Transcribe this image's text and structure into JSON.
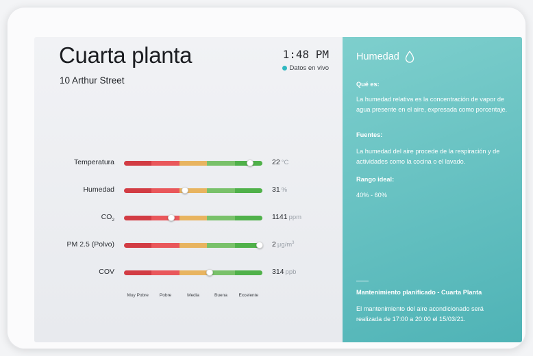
{
  "header": {
    "title": "Cuarta planta",
    "address": "10 Arthur Street",
    "time": "1:48 PM",
    "live_label": "Datos en vivo"
  },
  "metrics": [
    {
      "label": "Temperatura",
      "value": "22",
      "unit": "°C",
      "position": 0.91
    },
    {
      "label": "Humedad",
      "value": "31",
      "unit": "%",
      "position": 0.44
    },
    {
      "label": "CO",
      "label_sub": "2",
      "value": "1141",
      "unit": "ppm",
      "position": 0.34
    },
    {
      "label": "PM 2.5 (Polvo)",
      "value": "2",
      "unit": "μg/m",
      "unit_sup": "3",
      "position": 0.98
    },
    {
      "label": "COV",
      "value": "314",
      "unit": "ppb",
      "position": 0.62
    }
  ],
  "scale_labels": [
    "Muy Pobre",
    "Pobre",
    "Media",
    "Buena",
    "Excelente"
  ],
  "colors": {
    "very_poor": "#d23c44",
    "poor": "#e9575b",
    "medium": "#e8b460",
    "good": "#79c16a",
    "excellent": "#50b14a",
    "info_panel": "#5cbcbd",
    "live_dot": "#2fb8c0"
  },
  "info": {
    "title": "Humedad",
    "icon": "water-drop-icon",
    "what_heading": "Qué es:",
    "what_text": "La humedad relativa es la concentración de vapor de agua presente en el aire, expresada como porcentaje.",
    "sources_heading": "Fuentes:",
    "sources_text": "La humedad del aire procede de la respiración y de actividades como la cocina o el lavado.",
    "range_heading": "Rango ideal:",
    "range_text": "40% - 60%",
    "maintenance_heading": "Mantenimiento planificado - Cuarta Planta",
    "maintenance_text": "El mantenimiento del aire acondicionado será realizada de 17:00 a 20:00 el 15/03/21."
  }
}
